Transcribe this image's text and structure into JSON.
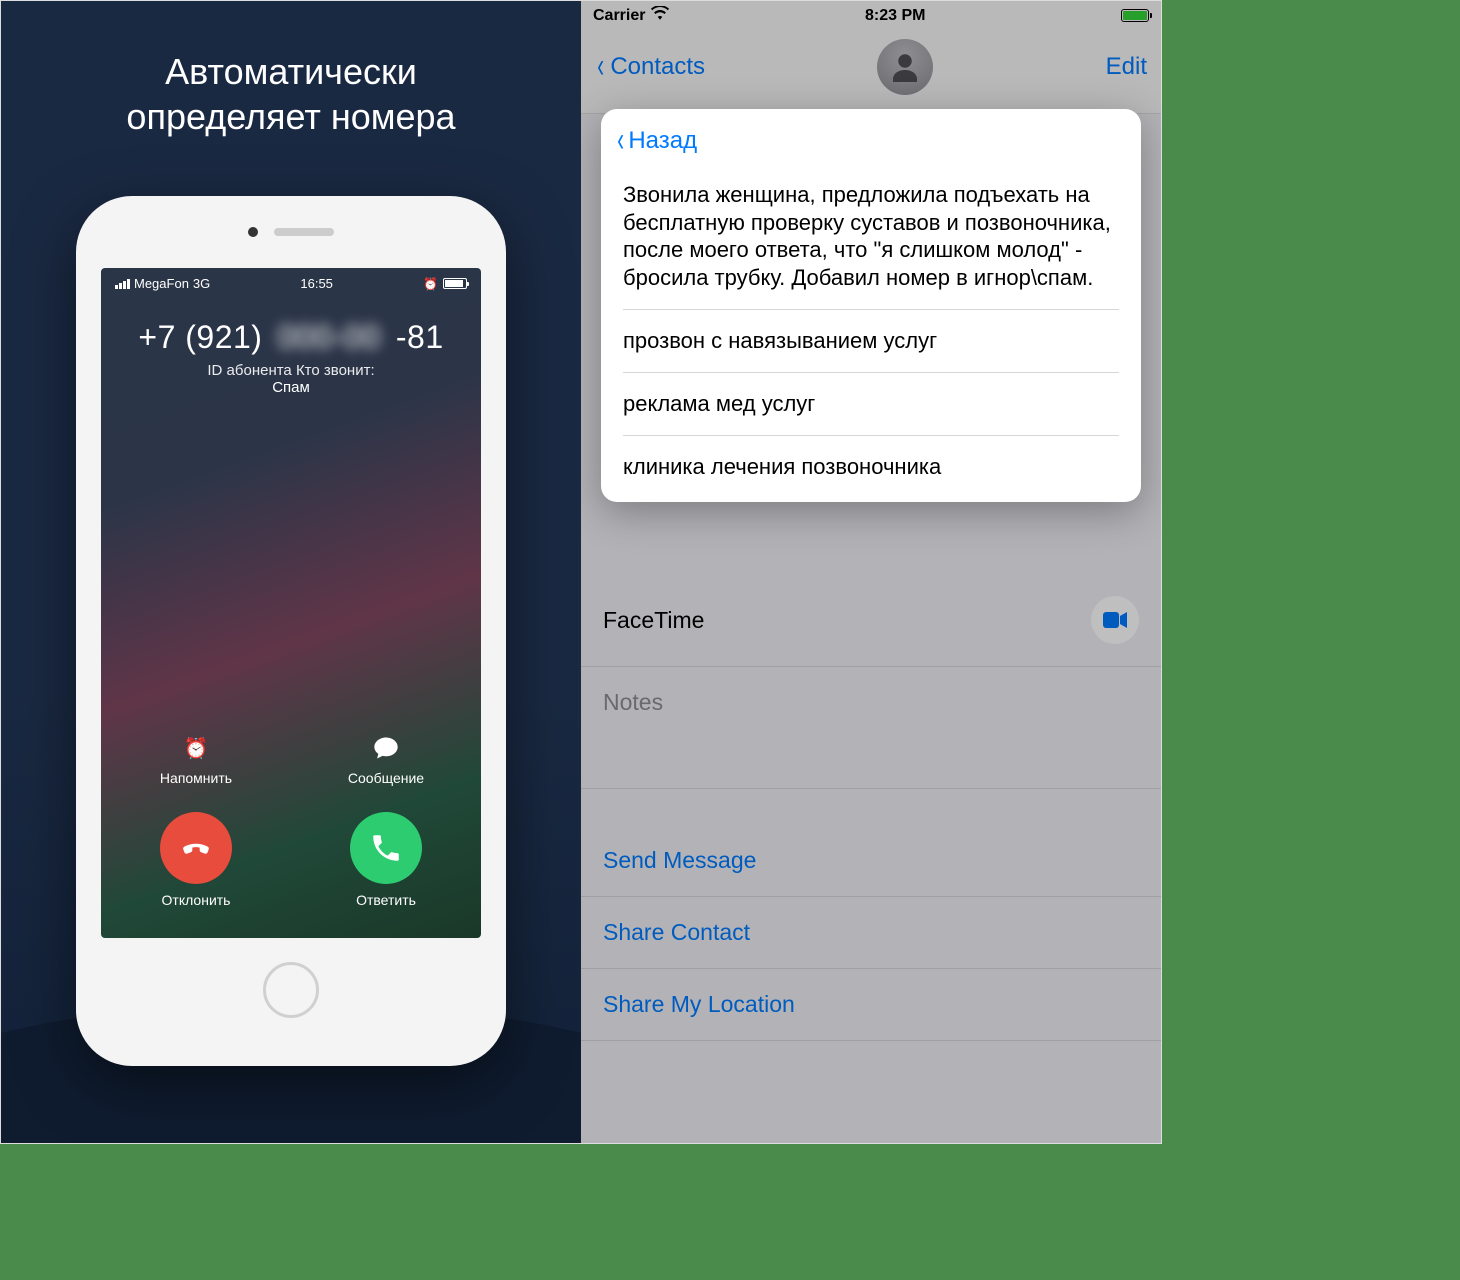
{
  "promo": {
    "title_line1": "Автоматически",
    "title_line2": "определяет номера"
  },
  "call_screen": {
    "statusbar": {
      "carrier": "MegaFon",
      "network": "3G",
      "time": "16:55"
    },
    "number_prefix": "+7 (921)",
    "number_mid": "000-00",
    "number_suffix": "-81",
    "caller_id_caption": "ID абонента Кто звонит:",
    "caller_id_tag": "Спам",
    "actions": {
      "remind": "Напомнить",
      "message": "Сообщение",
      "decline": "Отклонить",
      "answer": "Ответить"
    }
  },
  "ios": {
    "statusbar": {
      "carrier": "Carrier",
      "time": "8:23 PM"
    },
    "nav": {
      "back": "Contacts",
      "edit": "Edit"
    },
    "rows": {
      "facetime": "FaceTime",
      "notes": "Notes",
      "send_message": "Send Message",
      "share_contact": "Share Contact",
      "share_location": "Share My Location"
    }
  },
  "popup": {
    "back": "Назад",
    "paragraph": "Звонила женщина, предложила подъехать на бесплатную проверку суставов и позвоночника, после моего ответа, что \"я слишком молод\" - бросила трубку. Добавил номер в игнор\\спам.",
    "lines": [
      "прозвон с навязыванием услуг",
      "реклама мед услуг",
      "клиника лечения позвоночника"
    ]
  },
  "colors": {
    "ios_blue": "#007aff",
    "decline_red": "#e74c3c",
    "answer_green": "#2ecc71",
    "battery_green": "#35d43a"
  }
}
